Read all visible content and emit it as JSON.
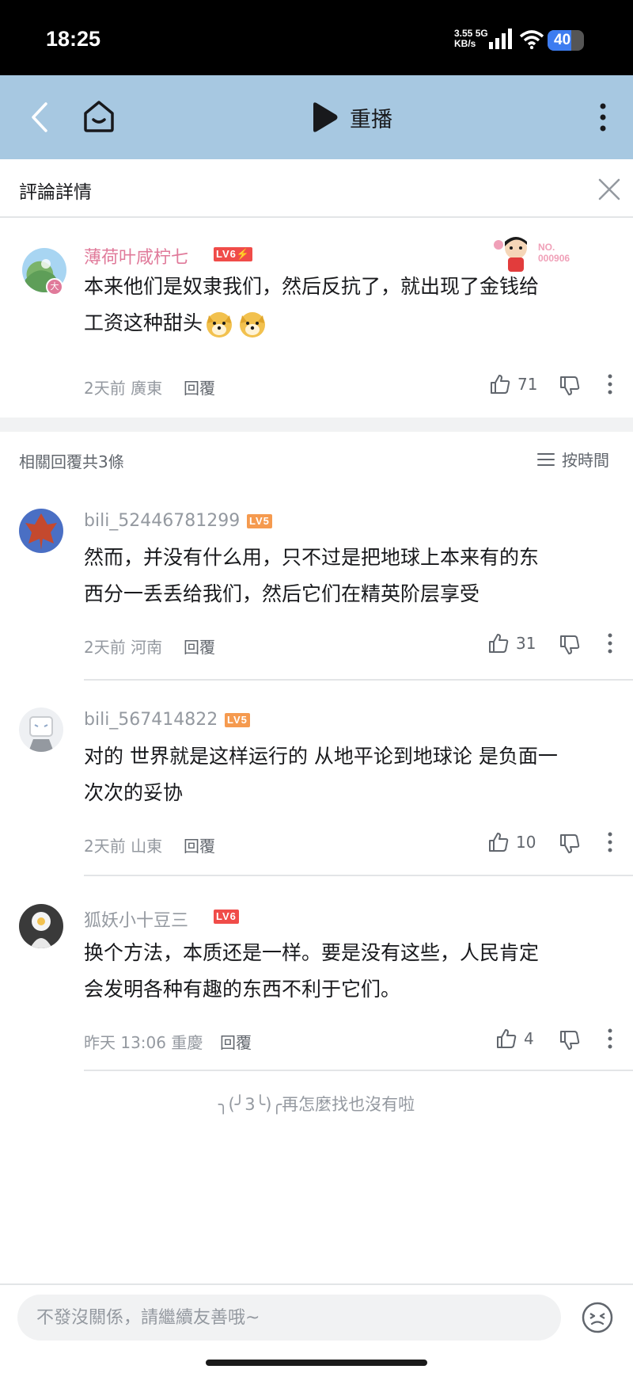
{
  "status_bar": {
    "time": "18:25",
    "net_speed_top": "3.55 5G",
    "net_speed_unit": "KB/s",
    "battery": "40"
  },
  "nav": {
    "replay_label": "重播"
  },
  "detail": {
    "title": "評論詳情"
  },
  "main_comment": {
    "username": "薄荷叶咸柠七",
    "username_color": "#e07a9a",
    "level": "LV6⚡",
    "decoration_label": "NO.",
    "decoration_number": "000906",
    "content_line1": "本来他们是奴隶我们，然后反抗了，就出现了金钱给",
    "content_line2": "工资这种甜头",
    "avatar_badge": "大",
    "time": "2天前",
    "location": "廣東",
    "reply_label": "回覆",
    "likes": "71"
  },
  "replies_header": {
    "count_label": "相關回覆共3條",
    "sort_label": "按時間"
  },
  "replies": [
    {
      "username": "bili_52446781299",
      "level": "LV5",
      "level_color": "#f59a4f",
      "content_line1": "然而，并没有什么用，只不过是把地球上本来有的东",
      "content_line2": "西分一丢丢给我们，然后它们在精英阶层享受",
      "time": "2天前",
      "location": "河南",
      "reply_label": "回覆",
      "likes": "31"
    },
    {
      "username": "bili_567414822",
      "level": "LV5",
      "level_color": "#f59a4f",
      "content_line1": "对的 世界就是这样运行的 从地平论到地球论 是负面一",
      "content_line2": "次次的妥协",
      "time": "2天前",
      "location": "山東",
      "reply_label": "回覆",
      "likes": "10"
    },
    {
      "username": "狐妖小十豆三",
      "level": "LV6",
      "level_color": "#f04c49",
      "content_line1": "换个方法，本质还是一样。要是没有这些，人民肯定",
      "content_line2": "会发明各种有趣的东西不利于它们。",
      "time": "昨天 13:06",
      "location": "重慶",
      "reply_label": "回覆",
      "likes": "4"
    }
  ],
  "end_note": "╮(╯3╰)╭再怎麼找也沒有啦",
  "input": {
    "placeholder": "不發沒關係，請繼續友善哦~"
  },
  "icons": [
    "back-icon",
    "home-icon",
    "play-icon",
    "more-icon",
    "close-icon",
    "like-icon",
    "dislike-icon",
    "sort-icon",
    "emote-icon"
  ]
}
